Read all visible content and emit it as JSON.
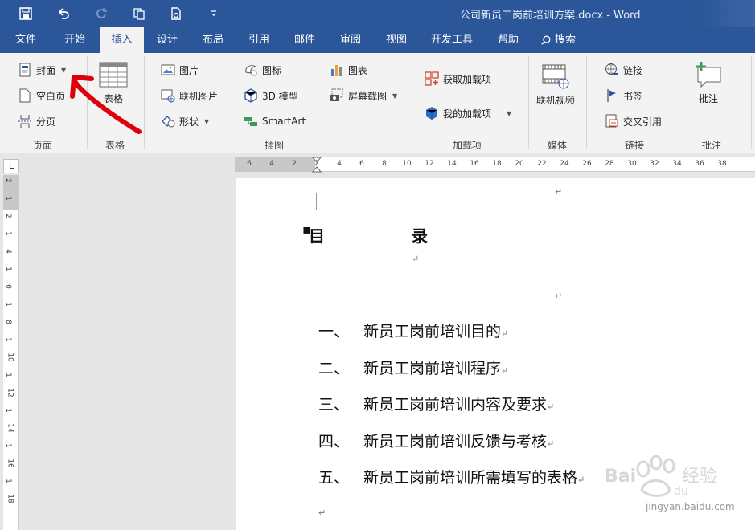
{
  "titlebar": {
    "document_title": "公司新员工岗前培训方案.docx  -  Word"
  },
  "tabs": [
    {
      "label": "文件"
    },
    {
      "label": "开始"
    },
    {
      "label": "插入"
    },
    {
      "label": "设计"
    },
    {
      "label": "布局"
    },
    {
      "label": "引用"
    },
    {
      "label": "邮件"
    },
    {
      "label": "审阅"
    },
    {
      "label": "视图"
    },
    {
      "label": "开发工具"
    },
    {
      "label": "帮助"
    },
    {
      "label": "搜索"
    }
  ],
  "ribbon": {
    "pages": {
      "cover": "封面",
      "blank": "空白页",
      "break": "分页",
      "group": "页面"
    },
    "tables": {
      "table": "表格",
      "group": "表格"
    },
    "illustrations": {
      "picture": "图片",
      "online_picture": "联机图片",
      "shapes": "形状",
      "icons": "图标",
      "model3d": "3D 模型",
      "smartart": "SmartArt",
      "chart": "图表",
      "screenshot": "屏幕截图",
      "group": "插图"
    },
    "addins": {
      "get": "获取加载项",
      "mine": "我的加载项",
      "group": "加载项"
    },
    "media": {
      "video": "联机视频",
      "group": "媒体"
    },
    "links": {
      "link": "链接",
      "bookmark": "书签",
      "crossref": "交叉引用",
      "group": "链接"
    },
    "comments": {
      "comment": "批注",
      "group": "批注"
    }
  },
  "rulers": {
    "corner": "L",
    "h_ticks": [
      "6",
      "4",
      "2",
      "2",
      "4",
      "6",
      "8",
      "10",
      "12",
      "14",
      "16",
      "18",
      "20",
      "22",
      "24",
      "26",
      "28",
      "30",
      "32",
      "34",
      "36",
      "38"
    ],
    "v_ticks": [
      "2",
      "1",
      "2",
      "1",
      "4",
      "1",
      "6",
      "1",
      "8",
      "1",
      "10",
      "1",
      "12",
      "1",
      "14",
      "1",
      "16",
      "1",
      "18"
    ]
  },
  "document": {
    "title_left": "目",
    "title_right": "录",
    "items": [
      {
        "num": "一、",
        "text": "新员工岗前培训目的"
      },
      {
        "num": "二、",
        "text": "新员工岗前培训程序"
      },
      {
        "num": "三、",
        "text": "新员工岗前培训内容及要求"
      },
      {
        "num": "四、",
        "text": "新员工岗前培训反馈与考核"
      },
      {
        "num": "五、",
        "text": "新员工岗前培训所需填写的表格"
      }
    ],
    "para_mark": "↵"
  },
  "watermark": {
    "text": "jingyan.baidu.com",
    "brand": "Bai du 经验"
  },
  "colors": {
    "accent": "#2b579a",
    "annotation": "#e0000b"
  }
}
